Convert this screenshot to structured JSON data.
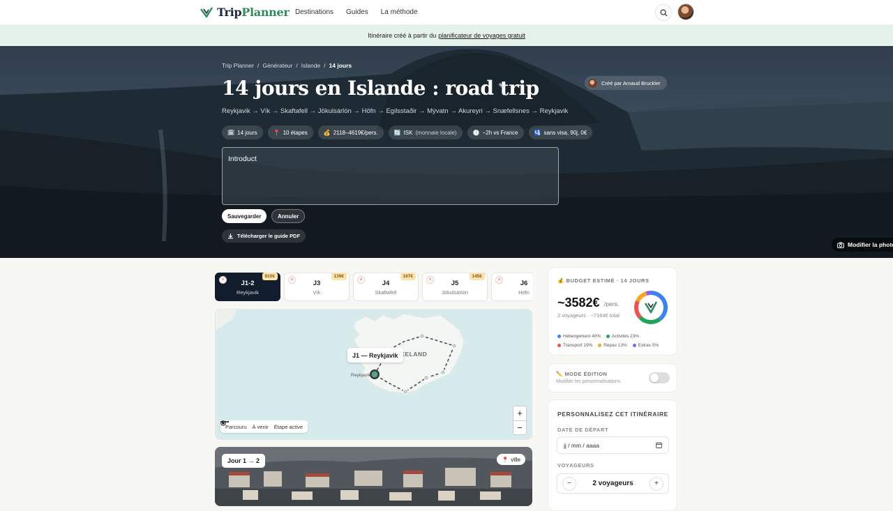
{
  "brand": {
    "name_a": "Trip",
    "name_b": "Planner",
    "color_dark": "#1b2a3a",
    "color_green": "#2f8a60"
  },
  "nav": {
    "links": [
      "Destinations",
      "Guides",
      "La méthode"
    ]
  },
  "banner": {
    "text": "Itinéraire créé à partir du",
    "link": "planificateur de voyages gratuit"
  },
  "breadcrumb": [
    "Trip Planner",
    "Générateur",
    "Islande",
    "14 jours"
  ],
  "title": "14 jours en Islande : road trip",
  "creator": "Créé par Arnaud Bruckler",
  "route": "Reykjavik → Vík → Skaftafell → Jökulsárlón → Höfn → Egilsstaðir → Mývatn → Akureyri → Snæfellsnes → Reykjavik",
  "pills": [
    {
      "icon": "🗓",
      "text": "14 jours",
      "muted": ""
    },
    {
      "icon": "📍",
      "text": "10 étapes",
      "muted": ""
    },
    {
      "icon": "💰",
      "text": "2118–4619€/pers.",
      "muted": ""
    },
    {
      "icon": "🔄",
      "text": "ISK",
      "muted": "(monnaie locale)"
    },
    {
      "icon": "🕓",
      "text": "−2h vs France",
      "muted": ""
    },
    {
      "icon": "🛂",
      "text": "sans visa, 90j, 0€",
      "muted": ""
    }
  ],
  "intro": {
    "value": "Introduct"
  },
  "buttons": {
    "save": "Sauvegarder",
    "cancel": "Annuler",
    "pdf": "Télécharger le guide PDF",
    "photo": "Modifier la photo"
  },
  "tabs": [
    {
      "day": "J1-2",
      "name": "Reykjavik",
      "price": "910€",
      "active": true
    },
    {
      "day": "J3",
      "name": "Vík",
      "price": "139€",
      "active": false
    },
    {
      "day": "J4",
      "name": "Skaftafell",
      "price": "167€",
      "active": false
    },
    {
      "day": "J5",
      "name": "Jökulsárlón",
      "price": "145€",
      "active": false
    },
    {
      "day": "J6",
      "name": "Höfn",
      "price": "",
      "active": false
    }
  ],
  "map": {
    "country_label": "ICELAND",
    "city_label": "Reykjavik",
    "tooltip": "J1 — Reykjavik",
    "legend": [
      "Parcouru",
      "À venir",
      "Étape active"
    ],
    "zoom_in": "+",
    "zoom_out": "−"
  },
  "day_photo": {
    "badge": "Jour 1 → 2",
    "type": "ville",
    "type_icon": "📍"
  },
  "budget": {
    "label": "BUDGET ESTIMÉ · 14 JOURS",
    "amount": "~3582€",
    "per": "/pers.",
    "sub": "2 voyageurs · ~7164€ total",
    "breakdown": [
      {
        "name": "Hébergement 40%",
        "pct": 40,
        "color": "#3b82f6"
      },
      {
        "name": "Activités 23%",
        "pct": 23,
        "color": "#22a35a"
      },
      {
        "name": "Transport 19%",
        "pct": 19,
        "color": "#ef5350"
      },
      {
        "name": "Repas 13%",
        "pct": 13,
        "color": "#f5a623"
      },
      {
        "name": "Extras 5%",
        "pct": 5,
        "color": "#8b5cf6"
      }
    ]
  },
  "edit_mode": {
    "title": "MODE ÉDITION",
    "sub": "Modifier les personnalisations",
    "on": false
  },
  "customize": {
    "title": "PERSONNALISEZ CET ITINÉRAIRE",
    "date_label": "DATE DE DÉPART",
    "date_placeholder": "jj / mm / aaaa",
    "travelers_label": "VOYAGEURS",
    "travelers_value": "2 voyageurs",
    "minus": "−",
    "plus": "+"
  }
}
